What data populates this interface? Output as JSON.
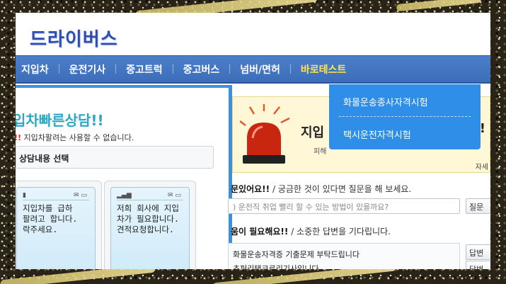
{
  "logo": "드라이버스",
  "nav": {
    "items": [
      "지입차",
      "운전기사",
      "중고트럭",
      "중고버스",
      "넘버/면허",
      "바로테스트"
    ],
    "active_index": 5
  },
  "dropdown": {
    "items": [
      "화물운송종사자격시험",
      "택시운전자격시험"
    ]
  },
  "left": {
    "title": "입차빠른상담!!",
    "notice_mark": "!!",
    "notice_text": "지입차팔려는 사용할 수 없습니다.",
    "select_label": "상담내용 선택",
    "cards": [
      {
        "text": "지입차를 급하\n팔려고 합니다.\n락주세요."
      },
      {
        "text": "저희 회사에 지입\n차가 필요합니다.\n견적요청합니다."
      }
    ]
  },
  "banner": {
    "title": "지입",
    "subtitle": "피해",
    "mark": "!!",
    "detail": "자세"
  },
  "question": {
    "heading": "문있어요!!",
    "subtext": "/ 궁금한 것이 있다면 질문을 해 보세요.",
    "placeholder": ") 운전직 취업 빨리 할 수 있는 방법이 있을까요?",
    "button": "질문"
  },
  "help": {
    "heading": "움이 필요해요!!",
    "subtext": "/ 소중한 답변을 기다립니다.",
    "items": [
      "화물운송자격증 기출문제 부탁드립니다",
      "초퍼리탱크로리기사입니다..."
    ],
    "buttons": [
      "답변",
      "답변"
    ]
  },
  "colors": {
    "nav_bg": "#3b6db9",
    "nav_active": "#ffe74a",
    "dropdown_bg": "#2f8fe8",
    "logo": "#2e4db0",
    "accent_teal": "#2aa8c4",
    "banner_bg": "#fff7d6"
  }
}
